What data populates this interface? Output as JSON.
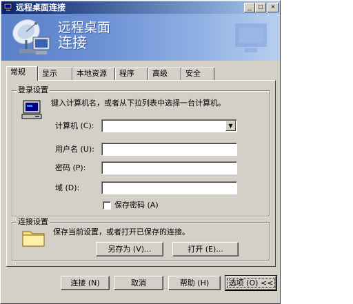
{
  "window": {
    "title": "远程桌面连接"
  },
  "title_buttons": {
    "minimize": "_",
    "maximize": "□",
    "close": "×"
  },
  "banner": {
    "line1": "远程桌面",
    "line2": "连接"
  },
  "tabs": [
    {
      "label": "常规",
      "active": true
    },
    {
      "label": "显示"
    },
    {
      "label": "本地资源"
    },
    {
      "label": "程序"
    },
    {
      "label": "高级"
    },
    {
      "label": "安全"
    }
  ],
  "login": {
    "title": "登录设置",
    "description": "键入计算机名，或者从下拉列表中选择一台计算机。",
    "computer_label": "计算机 (C):",
    "computer_value": "",
    "username_label": "用户名 (U):",
    "username_value": "",
    "password_label": "密码 (P):",
    "password_value": "",
    "domain_label": "域 (D):",
    "domain_value": "",
    "save_password_label": "保存密码 (A)",
    "save_password_checked": false
  },
  "connection": {
    "title": "连接设置",
    "description": "保存当前设置，或者打开已保存的连接。",
    "save_as_label": "另存为 (V)...",
    "open_label": "打开 (E)..."
  },
  "footer": {
    "connect_label": "连接 (N)",
    "cancel_label": "取消",
    "help_label": "帮助 (H)",
    "options_label": "选项 (O) <<"
  },
  "icons": {
    "title": "remote-desktop-icon",
    "banner": "satellite-dish-computer-icon",
    "login": "computer-icon",
    "connection": "folder-icon"
  },
  "colors": {
    "titlebar_start": "#0a246a",
    "titlebar_end": "#a6caf0",
    "dialog": "#d4d0c8",
    "banner": "#6c90d4"
  }
}
